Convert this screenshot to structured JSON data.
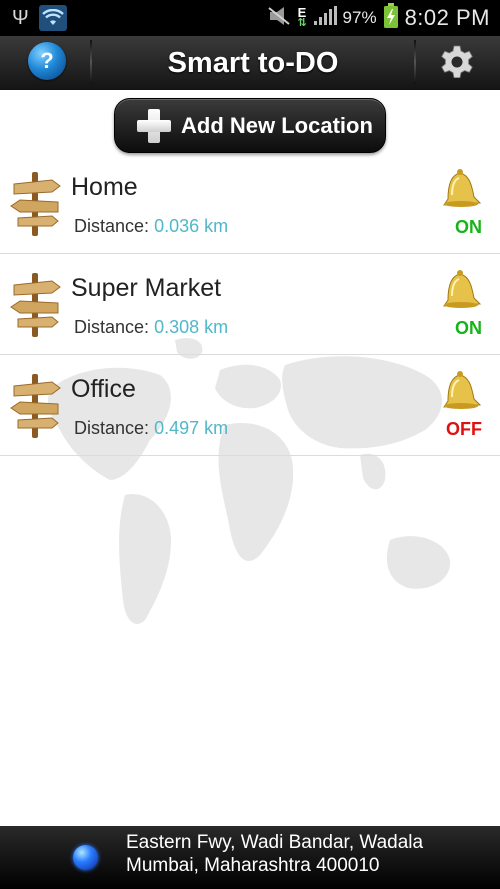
{
  "status_bar": {
    "battery_pct": "97%",
    "time": "8:02 PM",
    "network_type": "E",
    "icons": [
      "usb-icon",
      "wifi-icon",
      "mute-icon",
      "network-e-icon",
      "signal-icon",
      "battery-charging-icon"
    ]
  },
  "header": {
    "title": "Smart to-DO",
    "help_icon": "question-mark",
    "settings_icon": "gear"
  },
  "main": {
    "add_button_label": "Add New Location",
    "distance_label": "Distance:",
    "locations": [
      {
        "name": "Home",
        "distance": "0.036 km",
        "status": "ON"
      },
      {
        "name": "Super Market",
        "distance": "0.308 km",
        "status": "ON"
      },
      {
        "name": "Office",
        "distance": "0.497 km",
        "status": "OFF"
      }
    ]
  },
  "footer": {
    "address_line1": "Eastern Fwy, Wadi Bandar, Wadala",
    "address_line2": "Mumbai, Maharashtra 400010"
  },
  "colors": {
    "status_on": "#17b417",
    "status_off": "#e01010",
    "distance_value": "#4fb8c8"
  }
}
